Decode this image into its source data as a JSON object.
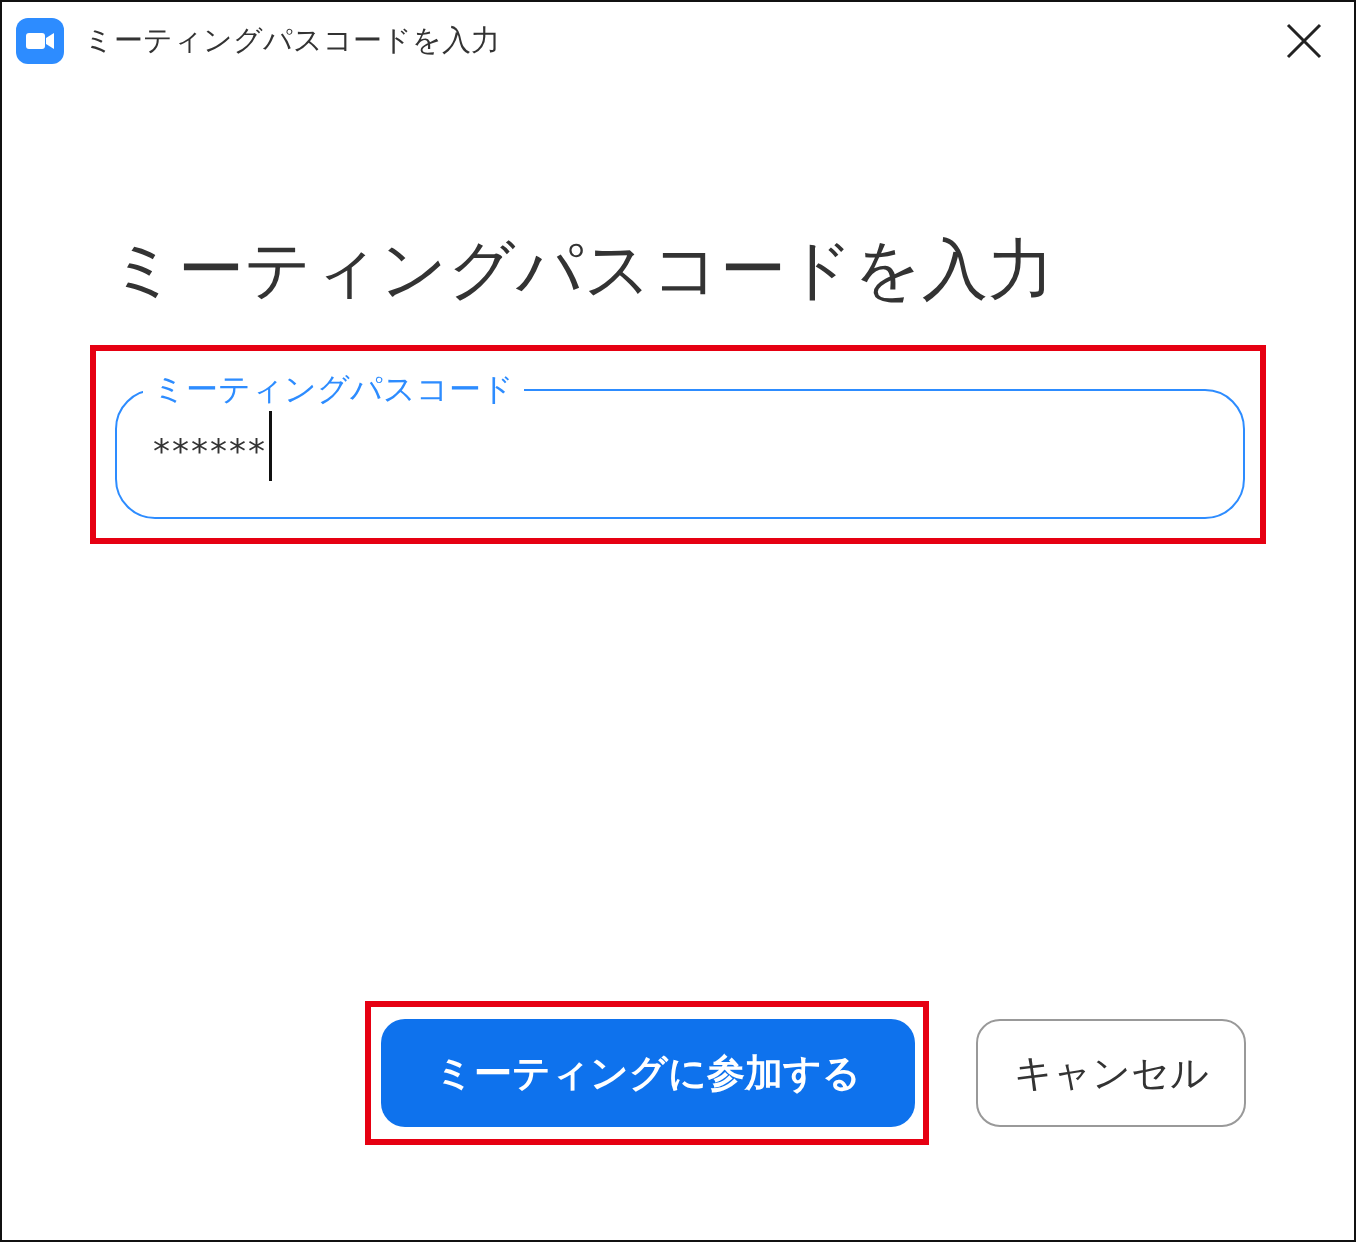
{
  "window": {
    "title": "ミーティングパスコードを入力"
  },
  "heading": "ミーティングパスコードを入力",
  "passcode_field": {
    "label": "ミーティングパスコード",
    "value": "******",
    "focused": true,
    "highlighted": true
  },
  "buttons": [
    {
      "label": "ミーティングに参加する",
      "kind": "primary",
      "highlighted": true
    },
    {
      "label": "キャンセル",
      "kind": "secondary",
      "highlighted": false
    }
  ]
}
